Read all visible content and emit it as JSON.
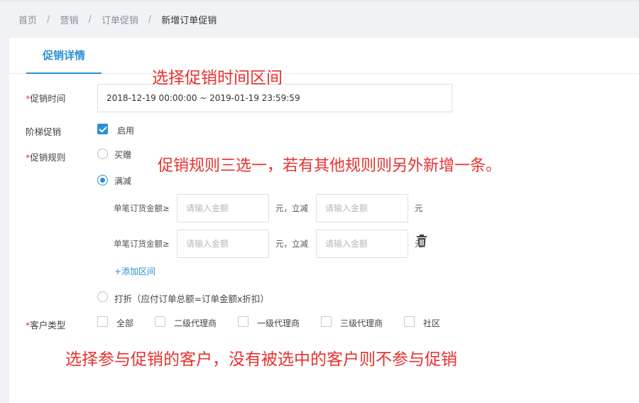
{
  "breadcrumb": {
    "items": [
      "首页",
      "营销",
      "订单促销"
    ],
    "separator": "/",
    "current": "新增订单促销"
  },
  "tabs": [
    {
      "label": "促销详情",
      "active": true
    }
  ],
  "form": {
    "promo_time": {
      "label": "促销时间",
      "value": "2018-12-19 00:00:00 ~ 2019-01-19 23:59:59"
    },
    "tiered": {
      "label": "阶梯促销",
      "checkbox_label": "启用",
      "checked": true
    },
    "rules": {
      "label": "促销规则",
      "options": {
        "gift": {
          "label": "买赠",
          "selected": false
        },
        "reduce": {
          "label": "满减",
          "selected": true
        },
        "discount": {
          "label": "打折（应付订单总额=订单金额x折扣）",
          "selected": false
        }
      },
      "tiers": [
        {
          "amount_label": "单笔订货金额≥",
          "amount_placeholder": "请输入金额",
          "mid_label": "元，立减",
          "reduce_placeholder": "请输入金额",
          "unit": "元"
        },
        {
          "amount_label": "单笔订货金额≥",
          "amount_placeholder": "请输入金额",
          "mid_label": "元，立减",
          "reduce_placeholder": "请输入金额",
          "unit": "元"
        }
      ],
      "add_range": "+添加区间"
    },
    "customer_type": {
      "label": "客户类型",
      "options": [
        "全部",
        "二级代理商",
        "一级代理商",
        "三级代理商",
        "社区"
      ]
    }
  },
  "annotations": {
    "time": "选择促销时间区间",
    "rules": "促销规则三选一，若有其他规则则另外新增一条。",
    "customers": "选择参与促销的客户，没有被选中的客户则不参与促销"
  },
  "icons": {
    "delete": "trash-icon",
    "check": "check-icon"
  },
  "colors": {
    "accent": "#2b8fd3",
    "required": "#e63a3a",
    "annotation": "#e8312f"
  }
}
